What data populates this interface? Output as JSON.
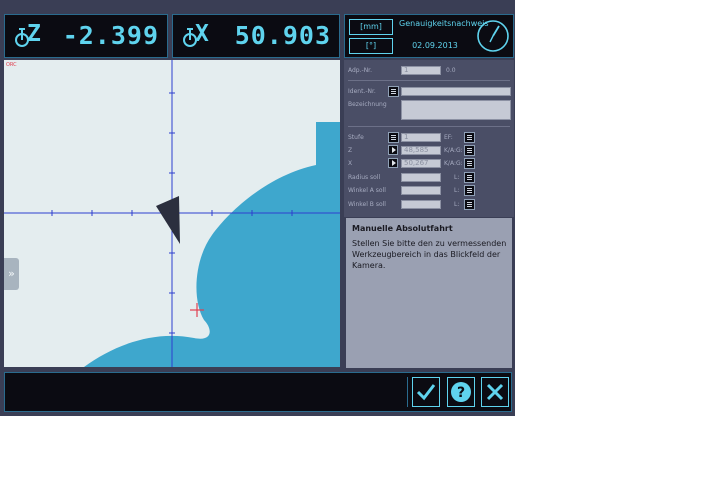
{
  "readouts": {
    "z": {
      "axis": "Z",
      "value": "-2.399",
      "icon": "axis-z-icon"
    },
    "x": {
      "axis": "X",
      "value": "50.903",
      "icon": "axis-x-icon"
    }
  },
  "info": {
    "mm_label": "[mm]",
    "deg_label": "[°]",
    "program_title": "Genauigkeitsnachweis",
    "date": "02.09.2013",
    "clock_icon": "clock-icon"
  },
  "form": {
    "adapter_label": "Adp.-Nr.",
    "adapter_value": "1",
    "adapter_extra": "0.0",
    "ident_label": "Ident.-Nr.",
    "ident_value": "",
    "desc_label": "Bezeichnung",
    "desc_value": "",
    "stufe_label": "Stufe",
    "stufe_value": "1",
    "z_label": "Z",
    "z_value": "48,585",
    "x_label": "X",
    "x_value": "50,267",
    "radius_label": "Radius soll",
    "winkel_a_label": "Winkel A soll",
    "winkel_b_label": "Winkel B soll",
    "unit_labels": [
      "EF:",
      "K/A:G:",
      "K/A:G:",
      "L:",
      "L:",
      "L:"
    ]
  },
  "message": {
    "title": "Manuelle Absolutfahrt",
    "text": "Stellen Sie bitte den zu vermessenden Werkzeugbereich in das Blickfeld der Kamera."
  },
  "camera": {
    "ruler_label": "ORC"
  },
  "colors": {
    "accent": "#5fd3ee",
    "tool_blue": "#3ea7cd",
    "crosshair": "#2d3fcf",
    "marker_red": "#e04050",
    "background": "#e4edef"
  },
  "buttons": {
    "ok": "check-icon",
    "help": "help-icon",
    "cancel": "close-icon"
  }
}
